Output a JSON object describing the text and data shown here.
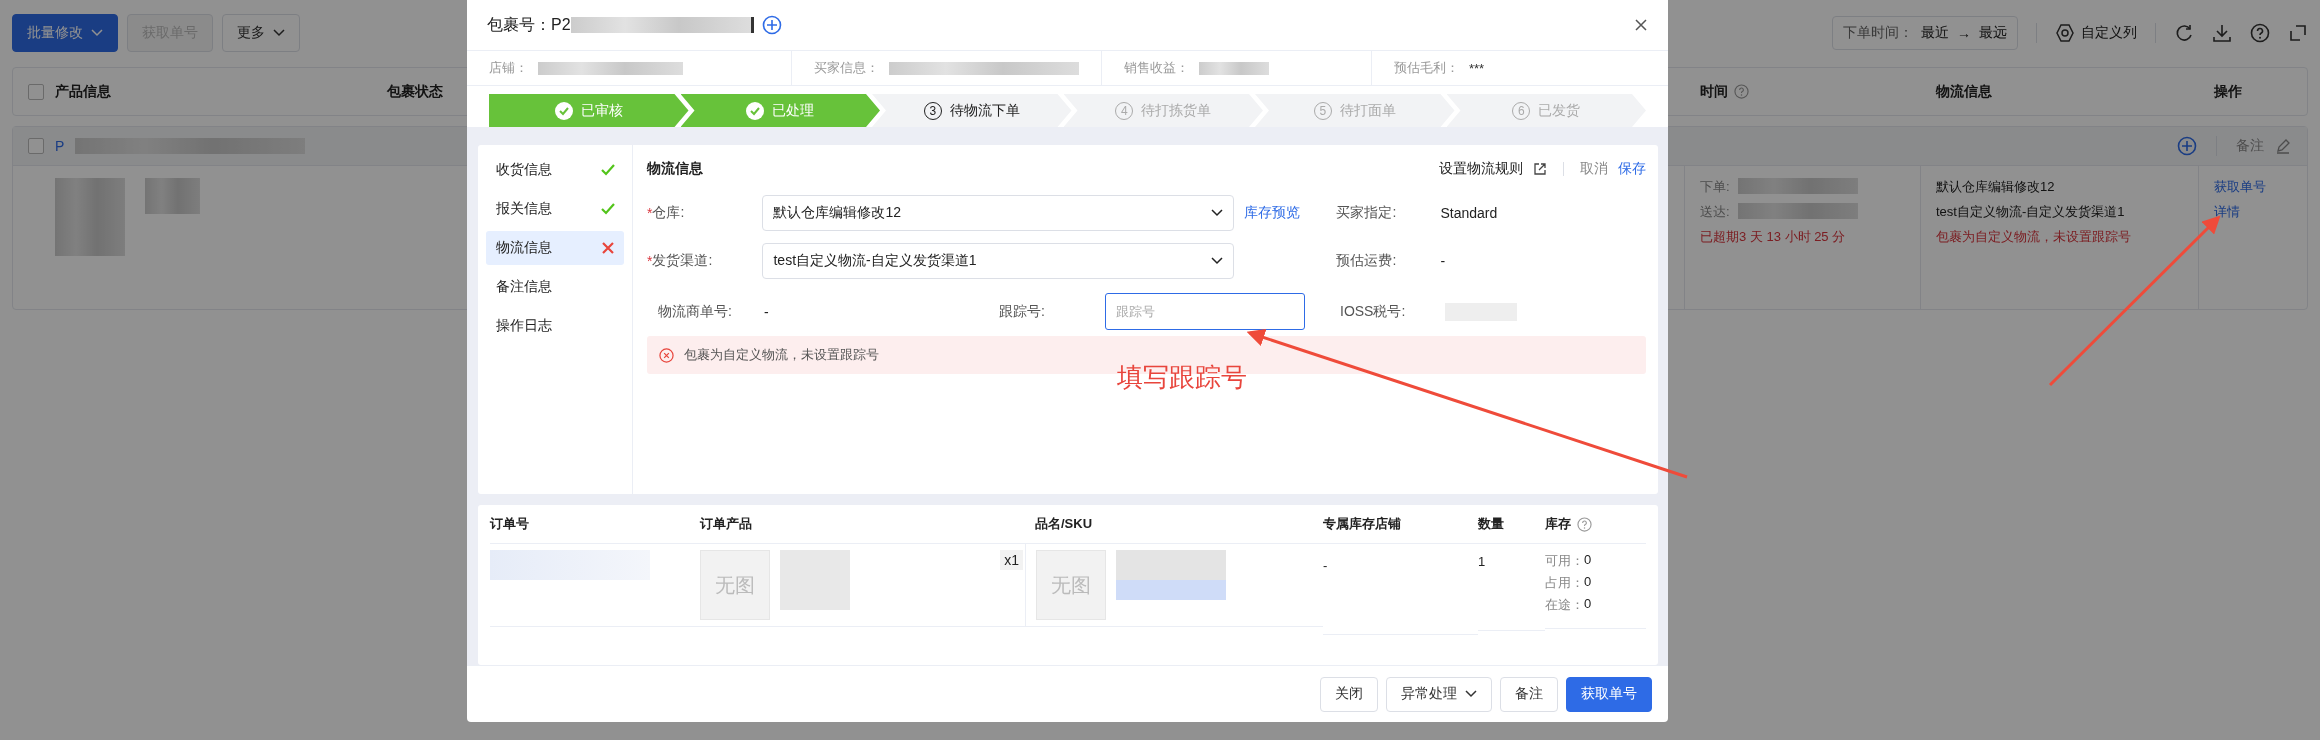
{
  "background": {
    "toolbar": {
      "buttons": [
        {
          "label": "批量修改",
          "kind": "primary",
          "dropdown": true,
          "disabled": false
        },
        {
          "label": "获取单号",
          "kind": "plain",
          "dropdown": false,
          "disabled": true
        },
        {
          "label": "更多",
          "kind": "plain",
          "dropdown": true,
          "disabled": false
        }
      ],
      "sort": {
        "label": "下单时间：",
        "from": "最近",
        "arrow": "→",
        "to": "最远"
      },
      "custom_columns": "自定义列"
    },
    "table": {
      "select_all": {
        "checked": false
      },
      "columns": [
        {
          "label": "产品信息",
          "help": false
        },
        {
          "label": "包裹状态",
          "help": false
        },
        {
          "label": "时间",
          "help": true
        },
        {
          "label": "物流信息",
          "help": false
        },
        {
          "label": "操作",
          "help": false
        }
      ],
      "rows": [
        {
          "checked": false,
          "package_no": "P",
          "note_label": "备注",
          "time": {
            "order_label": "下单:",
            "delivery_label": "送达:",
            "overdue": "已超期3 天 13 小时 25 分"
          },
          "logistics": [
            "默认仓库编辑修改12",
            "test自定义物流-自定义发货渠道1"
          ],
          "logistics_warning": "包裹为自定义物流，未设置跟踪号",
          "actions": [
            "获取单号",
            "详情"
          ]
        }
      ]
    }
  },
  "modal": {
    "title": "包裹号：P2",
    "info": [
      {
        "label": "店铺："
      },
      {
        "label": "买家信息："
      },
      {
        "label": "销售收益："
      },
      {
        "label": "预估毛利：",
        "value": "***"
      }
    ],
    "steps": [
      {
        "label": "已审核",
        "done": true,
        "active": false
      },
      {
        "label": "已处理",
        "done": true,
        "active": false
      },
      {
        "number": "3",
        "label": "待物流下单",
        "done": false,
        "active": true
      },
      {
        "number": "4",
        "label": "待打拣货单",
        "done": false,
        "active": false
      },
      {
        "number": "5",
        "label": "待打面单",
        "done": false,
        "active": false
      },
      {
        "number": "6",
        "label": "已发货",
        "done": false,
        "active": false
      }
    ],
    "nav": [
      {
        "label": "收货信息",
        "checked": true,
        "error": false,
        "selected": false
      },
      {
        "label": "报关信息",
        "checked": true,
        "error": false,
        "selected": false
      },
      {
        "label": "物流信息",
        "checked": false,
        "error": true,
        "selected": true
      },
      {
        "label": "备注信息",
        "checked": false,
        "error": false,
        "selected": false
      },
      {
        "label": "操作日志",
        "checked": false,
        "error": false,
        "selected": false
      }
    ],
    "section": {
      "title": "物流信息",
      "rule_link": "设置物流规则",
      "cancel": "取消",
      "save": "保存"
    },
    "form": {
      "warehouse": {
        "label": "仓库:",
        "required_mark": "*",
        "value": "默认仓库编辑修改12"
      },
      "stock_preview": "库存预览",
      "buyer_specified": {
        "label": "买家指定:",
        "value": "Standard"
      },
      "channel": {
        "label": "发货渠道:",
        "required_mark": "*",
        "value": "test自定义物流-自定义发货渠道1"
      },
      "est_shipping": {
        "label": "预估运费:",
        "value": "-"
      },
      "carrier_no": {
        "label": "物流商单号:",
        "value": "-"
      },
      "tracking": {
        "label": "跟踪号:",
        "placeholder": "跟踪号"
      },
      "ioss": {
        "label": "IOSS税号:"
      }
    },
    "alert": "包裹为自定义物流，未设置跟踪号",
    "order_table": {
      "columns": [
        {
          "label": "订单号",
          "help": false
        },
        {
          "label": "订单产品",
          "help": false
        },
        {
          "label": "品名/SKU",
          "help": false
        },
        {
          "label": "专属库存店铺",
          "help": false
        },
        {
          "label": "数量",
          "help": false
        },
        {
          "label": "库存",
          "help": true
        }
      ],
      "rows": [
        {
          "product": {
            "image": "无图",
            "qty": "x1"
          },
          "sku": {
            "image": "无图"
          },
          "store": "-",
          "quantity": "1",
          "stock": [
            {
              "label": "可用：",
              "value": "0"
            },
            {
              "label": "占用：",
              "value": "0"
            },
            {
              "label": "在途：",
              "value": "0"
            }
          ]
        }
      ]
    },
    "footer_buttons": [
      {
        "label": "关闭",
        "kind": "plain",
        "dropdown": false
      },
      {
        "label": "异常处理",
        "kind": "plain",
        "dropdown": true
      },
      {
        "label": "备注",
        "kind": "plain",
        "dropdown": false
      },
      {
        "label": "获取单号",
        "kind": "primary",
        "dropdown": false
      }
    ]
  },
  "annotation": {
    "label": "填写跟踪号"
  }
}
